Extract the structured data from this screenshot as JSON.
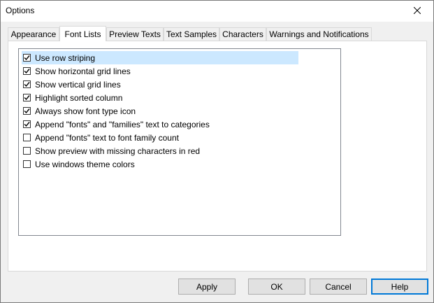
{
  "window": {
    "title": "Options"
  },
  "tabs": [
    {
      "label": "Appearance",
      "active": false
    },
    {
      "label": "Font Lists",
      "active": true
    },
    {
      "label": "Preview Texts",
      "active": false
    },
    {
      "label": "Text Samples",
      "active": false
    },
    {
      "label": "Characters",
      "active": false
    },
    {
      "label": "Warnings and Notifications",
      "active": false
    }
  ],
  "options": [
    {
      "label": "Use row striping",
      "checked": true,
      "selected": true
    },
    {
      "label": "Show horizontal grid lines",
      "checked": true
    },
    {
      "label": "Show vertical grid lines",
      "checked": true
    },
    {
      "label": "Highlight sorted column",
      "checked": true
    },
    {
      "label": "Always show font type icon",
      "checked": true
    },
    {
      "label": "Append \"fonts\" and \"families\" text to categories",
      "checked": true
    },
    {
      "label": "Append \"fonts\" text to font family count",
      "checked": false
    },
    {
      "label": "Show preview with missing characters in red",
      "checked": false
    },
    {
      "label": "Use windows theme colors",
      "checked": false
    }
  ],
  "buttons": {
    "apply": "Apply",
    "ok": "OK",
    "cancel": "Cancel",
    "help": "Help"
  },
  "colors": {
    "selection": "#cce8ff",
    "default_button_border": "#0078d7"
  }
}
